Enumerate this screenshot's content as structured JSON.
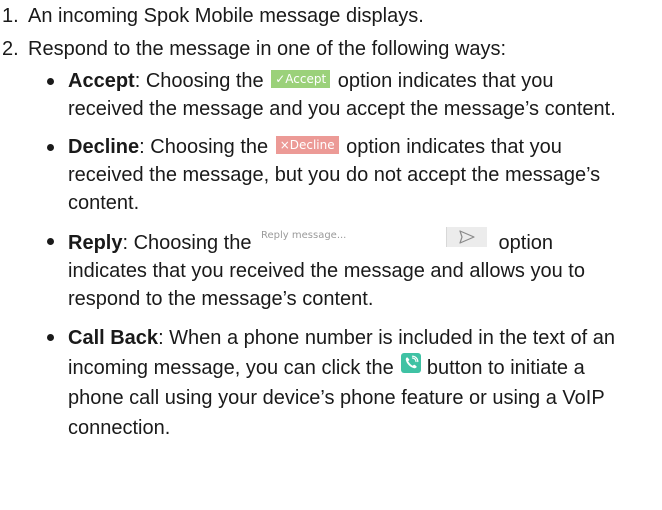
{
  "steps": [
    {
      "number": "1.",
      "text": "An incoming Spok Mobile message displays."
    },
    {
      "number": "2.",
      "text": "Respond to the message in one of the following ways:"
    }
  ],
  "options": {
    "accept": {
      "term": "Accept",
      "before": ": Choosing the ",
      "button_label": "✓Accept",
      "after": " option indicates that you received the message and you accept the message’s content."
    },
    "decline": {
      "term": "Decline",
      "before": ": Choosing the ",
      "button_label": "×Decline",
      "after": " option indicates that you received the message, but you do not accept the message’s content."
    },
    "reply": {
      "term": "Reply",
      "before": ": Choosing the ",
      "placeholder": "Reply message...",
      "after": " option indicates that you received the message and allows you to respond to the message’s content."
    },
    "callback": {
      "term": "Call Back",
      "before": ": When a phone number is included in the text of an incoming message, you can click the ",
      "after": " button to initiate a phone call using your device’s phone feature or using a VoIP connection."
    }
  },
  "colors": {
    "accept": "#9bd17a",
    "decline": "#ec9a96",
    "call": "#3fc2a4",
    "send_bg": "#ececec"
  },
  "icons": {
    "send": "send-arrow-icon",
    "call": "phone-call-icon"
  }
}
